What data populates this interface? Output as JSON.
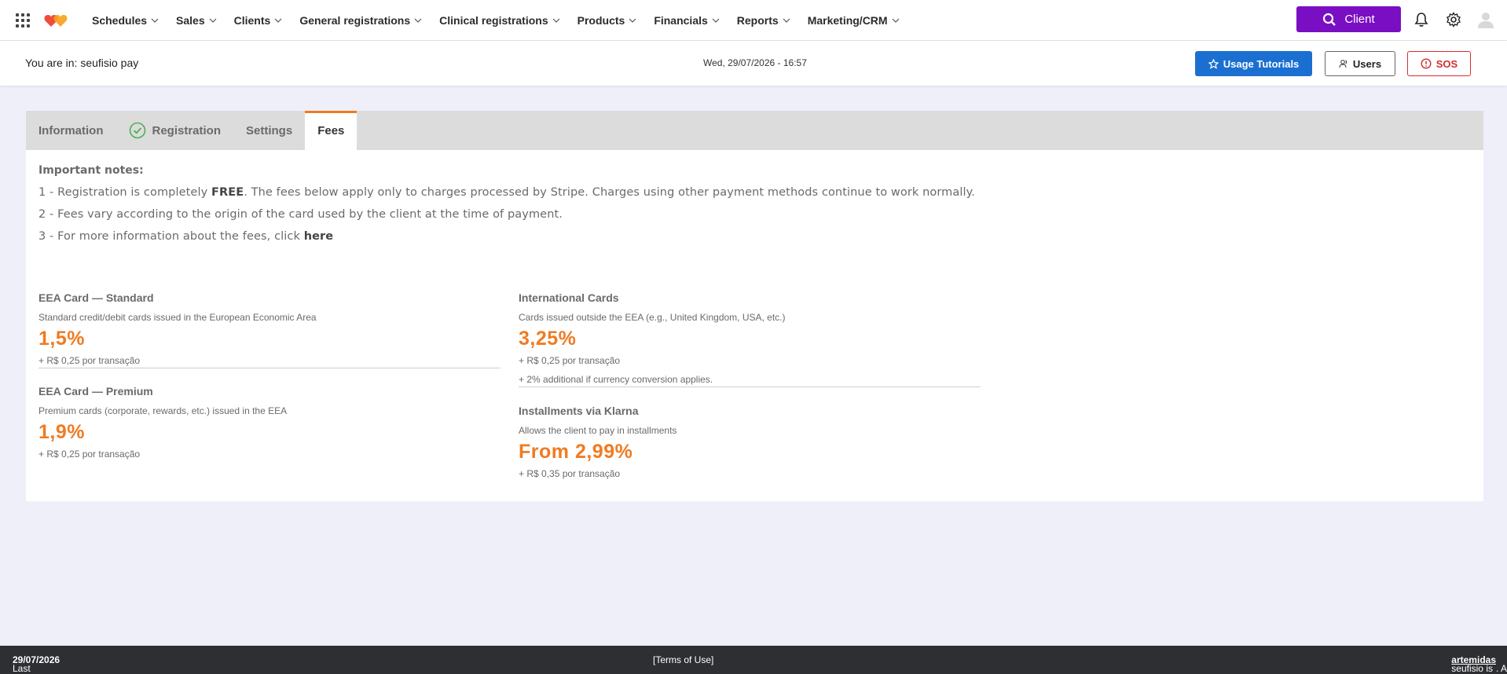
{
  "nav": {
    "menu": [
      {
        "label": "Schedules"
      },
      {
        "label": "Sales"
      },
      {
        "label": "Clients"
      },
      {
        "label": "General registrations"
      },
      {
        "label": "Clinical registrations"
      },
      {
        "label": "Products"
      },
      {
        "label": "Financials"
      },
      {
        "label": "Reports"
      },
      {
        "label": "Marketing/CRM"
      }
    ],
    "client_button": "Client"
  },
  "subheader": {
    "breadcrumb": "You are in: seufisio pay",
    "datetime": "Wed, 29/07/2026 - 16:57",
    "tutorials": "Usage Tutorials",
    "users": "Users",
    "sos": "SOS"
  },
  "tabs": {
    "information": "Information",
    "registration": "Registration",
    "settings": "Settings",
    "fees": "Fees"
  },
  "notes": {
    "title": "Important notes:",
    "n1_a": "1 - Registration is completely ",
    "n1_b": "FREE",
    "n1_c": ". The fees below apply only to charges processed by Stripe. Charges using other payment methods continue to work normally.",
    "n2": "2 - Fees vary according to the origin of the card used by the client at the time of payment.",
    "n3_a": "3 - For more information about the fees, click ",
    "n3_b": "here"
  },
  "fees": {
    "eea_standard": {
      "title": "EEA Card — Standard",
      "desc": "Standard credit/debit cards issued in the European Economic Area",
      "pct": "1,5%",
      "extra": "+ R$ 0,25 por transação"
    },
    "eea_premium": {
      "title": "EEA Card — Premium",
      "desc": "Premium cards (corporate, rewards, etc.) issued in the EEA",
      "pct": "1,9%",
      "extra": "+ R$ 0,25 por transação"
    },
    "international": {
      "title": "International Cards",
      "desc": "Cards issued outside the EEA (e.g., United Kingdom, USA, etc.)",
      "pct": "3,25%",
      "extra": "+ R$ 0,25 por transação",
      "extra2": "+ 2% additional if currency conversion applies."
    },
    "klarna": {
      "title": "Installments via Klarna",
      "desc": "Allows the client to pay in installments",
      "pct": "From 2,99%",
      "extra": "+ R$ 0,35 por transação"
    }
  },
  "footer": {
    "last_update_label": "Last update: ",
    "last_update_date": "29/07/2026",
    "terms": "[Terms of Use]",
    "credit_a": "seufisio is a solution by ",
    "credit_b": "artemidas",
    "credit_c": ". All rights reserved."
  },
  "colors": {
    "accent": "#f07b22",
    "client_button": "#7a0ec2",
    "tutorial_button": "#1a6fd1",
    "sos": "#d32f2f",
    "footer": "#2d2f33"
  }
}
